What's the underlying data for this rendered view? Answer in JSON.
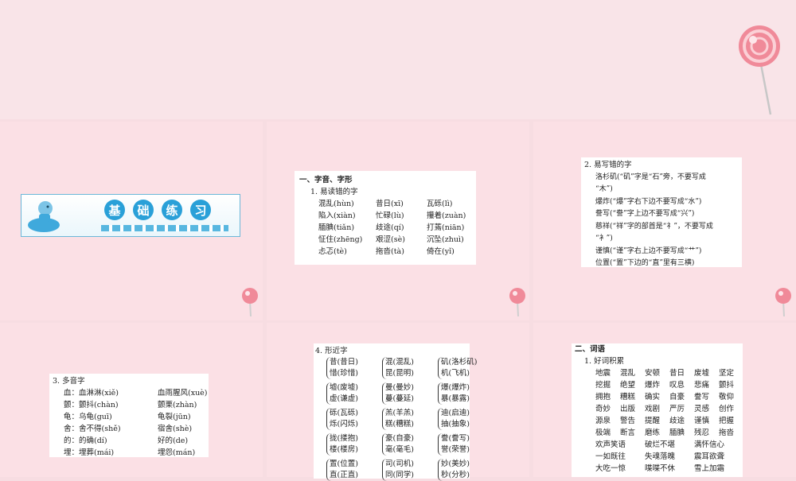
{
  "colors": {
    "background": "#f7dde2",
    "slide": "#fbe0e5",
    "accent": "#2aa0d8",
    "lollipop": "#f08a99"
  },
  "slide1": {
    "banner_chars": [
      "基",
      "础",
      "练",
      "习"
    ]
  },
  "slide2": {
    "section": "一、字音、字形",
    "subsection": "1. 易读错的字",
    "rows": [
      [
        "混乱(hùn)",
        "昔日(xī)",
        "瓦砾(lì)"
      ],
      [
        "陷入(xiàn)",
        "忙碌(lù)",
        "攥着(zuàn)"
      ],
      [
        "腼腆(tiǎn)",
        "歧途(qí)",
        "打蔫(niān)"
      ],
      [
        "怔住(zhēng)",
        "艰涩(sè)",
        "沉坠(zhuì)"
      ],
      [
        "忐忑(tè)",
        "拖沓(tà)",
        "倚在(yǐ)"
      ]
    ]
  },
  "slide3": {
    "subsection": "2. 易写错的字",
    "lines": [
      "洛杉矶(“矶”字是“石”旁，不要写成",
      "“木”)",
      "爆炸(“爆”字右下边不要写成“水”)",
      "誊写(“誊”字上边不要写成“兴”)",
      "慈祥(“祥”字的部首是“礻”，不要写成",
      "“衤”)",
      "谨慎(“谨”字右上边不要写成“艹”)",
      "位置(“置”下边的“直”里有三横)"
    ]
  },
  "slide4": {
    "subsection": "3. 多音字",
    "rows": [
      [
        "血：血淋淋(xiě)",
        "血雨腥风(xuè)"
      ],
      [
        "颤：颤抖(chàn)",
        "颤栗(zhàn)"
      ],
      [
        "龟：乌龟(guī)",
        "龟裂(jūn)"
      ],
      [
        "舍：舍不得(shě)",
        "宿舍(shè)"
      ],
      [
        "的：的确(dí)",
        "好的(de)"
      ],
      [
        "埋：埋葬(mái)",
        "埋怨(mán)"
      ]
    ]
  },
  "slide5": {
    "subsection": "4. 形近字",
    "groups": [
      [
        [
          "昔(昔日)",
          "惜(珍惜)"
        ],
        [
          "混(混乱)",
          "昆(昆明)"
        ],
        [
          "矶(洛杉矶)",
          "机(飞机)"
        ]
      ],
      [
        [
          "墟(废墟)",
          "虚(谦虚)"
        ],
        [
          "曼(曼妙)",
          "蔓(蔓延)"
        ],
        [
          "爆(爆炸)",
          "暴(暴露)"
        ]
      ],
      [
        [
          "砾(瓦砾)",
          "烁(闪烁)"
        ],
        [
          "羔(羊羔)",
          "糕(糟糕)"
        ],
        [
          "迪(启迪)",
          "抽(抽象)"
        ]
      ],
      [
        [
          "拢(搂抱)",
          "楼(楼房)"
        ],
        [
          "豪(自豪)",
          "毫(毫毛)"
        ],
        [
          "誊(誊写)",
          "誉(荣誉)"
        ]
      ],
      [
        [
          "置(位置)",
          "直(正直)"
        ],
        [
          "司(司机)",
          "同(同学)"
        ],
        [
          "妙(美妙)",
          "秒(分秒)"
        ]
      ]
    ]
  },
  "slide6": {
    "section": "二、词语",
    "subsection": "1. 好词积累",
    "grid": [
      [
        "地震",
        "混乱",
        "安顿",
        "昔日",
        "废墟",
        "坚定"
      ],
      [
        "挖掘",
        "绝望",
        "爆炸",
        "叹息",
        "悲痛",
        "颤抖"
      ],
      [
        "拥抱",
        "糟糕",
        "确实",
        "自豪",
        "誊写",
        "敬仰"
      ],
      [
        "奇妙",
        "出版",
        "戏剧",
        "严厉",
        "灵感",
        "创作"
      ],
      [
        "源泉",
        "警告",
        "提醒",
        "歧途",
        "谨慎",
        "把握"
      ],
      [
        "极端",
        "断言",
        "磨练",
        "腼腆",
        "残忍",
        "拖沓"
      ]
    ],
    "phrases": [
      [
        "欢声笑语",
        "破烂不堪",
        "满怀信心"
      ],
      [
        "一如既往",
        "失魂落魄",
        "震耳欲聋"
      ],
      [
        "大吃一惊",
        "喋喋不休",
        "雪上加霜"
      ]
    ]
  }
}
